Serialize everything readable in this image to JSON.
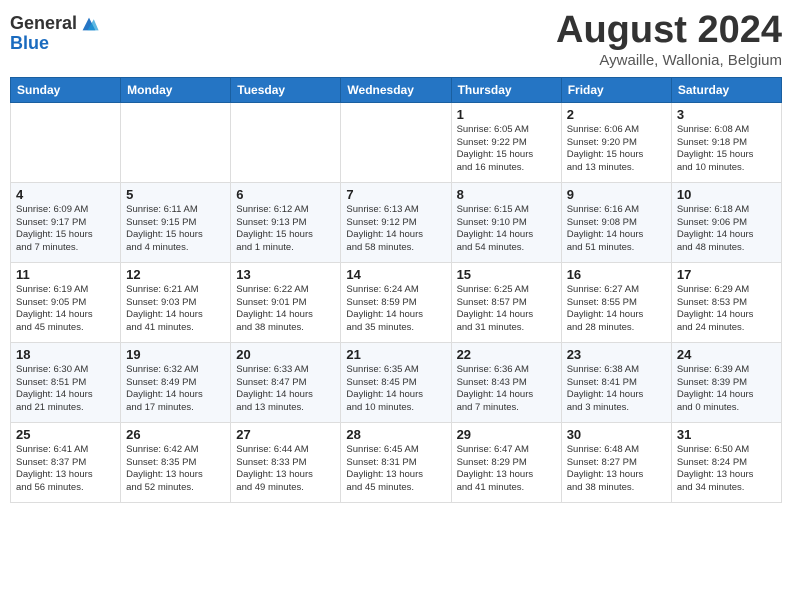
{
  "header": {
    "logo_general": "General",
    "logo_blue": "Blue",
    "month_year": "August 2024",
    "location": "Aywaille, Wallonia, Belgium"
  },
  "weekdays": [
    "Sunday",
    "Monday",
    "Tuesday",
    "Wednesday",
    "Thursday",
    "Friday",
    "Saturday"
  ],
  "weeks": [
    [
      {
        "day": "",
        "info": ""
      },
      {
        "day": "",
        "info": ""
      },
      {
        "day": "",
        "info": ""
      },
      {
        "day": "",
        "info": ""
      },
      {
        "day": "1",
        "info": "Sunrise: 6:05 AM\nSunset: 9:22 PM\nDaylight: 15 hours\nand 16 minutes."
      },
      {
        "day": "2",
        "info": "Sunrise: 6:06 AM\nSunset: 9:20 PM\nDaylight: 15 hours\nand 13 minutes."
      },
      {
        "day": "3",
        "info": "Sunrise: 6:08 AM\nSunset: 9:18 PM\nDaylight: 15 hours\nand 10 minutes."
      }
    ],
    [
      {
        "day": "4",
        "info": "Sunrise: 6:09 AM\nSunset: 9:17 PM\nDaylight: 15 hours\nand 7 minutes."
      },
      {
        "day": "5",
        "info": "Sunrise: 6:11 AM\nSunset: 9:15 PM\nDaylight: 15 hours\nand 4 minutes."
      },
      {
        "day": "6",
        "info": "Sunrise: 6:12 AM\nSunset: 9:13 PM\nDaylight: 15 hours\nand 1 minute."
      },
      {
        "day": "7",
        "info": "Sunrise: 6:13 AM\nSunset: 9:12 PM\nDaylight: 14 hours\nand 58 minutes."
      },
      {
        "day": "8",
        "info": "Sunrise: 6:15 AM\nSunset: 9:10 PM\nDaylight: 14 hours\nand 54 minutes."
      },
      {
        "day": "9",
        "info": "Sunrise: 6:16 AM\nSunset: 9:08 PM\nDaylight: 14 hours\nand 51 minutes."
      },
      {
        "day": "10",
        "info": "Sunrise: 6:18 AM\nSunset: 9:06 PM\nDaylight: 14 hours\nand 48 minutes."
      }
    ],
    [
      {
        "day": "11",
        "info": "Sunrise: 6:19 AM\nSunset: 9:05 PM\nDaylight: 14 hours\nand 45 minutes."
      },
      {
        "day": "12",
        "info": "Sunrise: 6:21 AM\nSunset: 9:03 PM\nDaylight: 14 hours\nand 41 minutes."
      },
      {
        "day": "13",
        "info": "Sunrise: 6:22 AM\nSunset: 9:01 PM\nDaylight: 14 hours\nand 38 minutes."
      },
      {
        "day": "14",
        "info": "Sunrise: 6:24 AM\nSunset: 8:59 PM\nDaylight: 14 hours\nand 35 minutes."
      },
      {
        "day": "15",
        "info": "Sunrise: 6:25 AM\nSunset: 8:57 PM\nDaylight: 14 hours\nand 31 minutes."
      },
      {
        "day": "16",
        "info": "Sunrise: 6:27 AM\nSunset: 8:55 PM\nDaylight: 14 hours\nand 28 minutes."
      },
      {
        "day": "17",
        "info": "Sunrise: 6:29 AM\nSunset: 8:53 PM\nDaylight: 14 hours\nand 24 minutes."
      }
    ],
    [
      {
        "day": "18",
        "info": "Sunrise: 6:30 AM\nSunset: 8:51 PM\nDaylight: 14 hours\nand 21 minutes."
      },
      {
        "day": "19",
        "info": "Sunrise: 6:32 AM\nSunset: 8:49 PM\nDaylight: 14 hours\nand 17 minutes."
      },
      {
        "day": "20",
        "info": "Sunrise: 6:33 AM\nSunset: 8:47 PM\nDaylight: 14 hours\nand 13 minutes."
      },
      {
        "day": "21",
        "info": "Sunrise: 6:35 AM\nSunset: 8:45 PM\nDaylight: 14 hours\nand 10 minutes."
      },
      {
        "day": "22",
        "info": "Sunrise: 6:36 AM\nSunset: 8:43 PM\nDaylight: 14 hours\nand 7 minutes."
      },
      {
        "day": "23",
        "info": "Sunrise: 6:38 AM\nSunset: 8:41 PM\nDaylight: 14 hours\nand 3 minutes."
      },
      {
        "day": "24",
        "info": "Sunrise: 6:39 AM\nSunset: 8:39 PM\nDaylight: 14 hours\nand 0 minutes."
      }
    ],
    [
      {
        "day": "25",
        "info": "Sunrise: 6:41 AM\nSunset: 8:37 PM\nDaylight: 13 hours\nand 56 minutes."
      },
      {
        "day": "26",
        "info": "Sunrise: 6:42 AM\nSunset: 8:35 PM\nDaylight: 13 hours\nand 52 minutes."
      },
      {
        "day": "27",
        "info": "Sunrise: 6:44 AM\nSunset: 8:33 PM\nDaylight: 13 hours\nand 49 minutes."
      },
      {
        "day": "28",
        "info": "Sunrise: 6:45 AM\nSunset: 8:31 PM\nDaylight: 13 hours\nand 45 minutes."
      },
      {
        "day": "29",
        "info": "Sunrise: 6:47 AM\nSunset: 8:29 PM\nDaylight: 13 hours\nand 41 minutes."
      },
      {
        "day": "30",
        "info": "Sunrise: 6:48 AM\nSunset: 8:27 PM\nDaylight: 13 hours\nand 38 minutes."
      },
      {
        "day": "31",
        "info": "Sunrise: 6:50 AM\nSunset: 8:24 PM\nDaylight: 13 hours\nand 34 minutes."
      }
    ]
  ]
}
